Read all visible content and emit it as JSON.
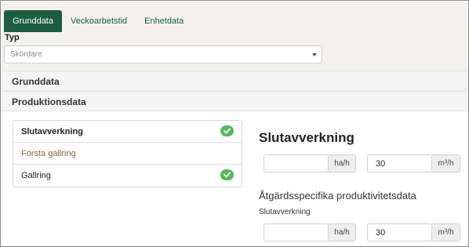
{
  "tabs": [
    {
      "label": "Grunddata",
      "active": true
    },
    {
      "label": "Veckoarbetstid",
      "active": false
    },
    {
      "label": "Enhetdata",
      "active": false
    }
  ],
  "typ": {
    "label": "Typ",
    "selected": "Skördare"
  },
  "sections": {
    "grunddata": "Grunddata",
    "produktionsdata": "Produktionsdata"
  },
  "list": {
    "items": [
      {
        "label": "Slutavverkning",
        "checked": true
      },
      {
        "label": "Första gallring",
        "checked": false
      },
      {
        "label": "Gallring",
        "checked": true
      }
    ]
  },
  "detail": {
    "title": "Slutavverkning",
    "row1": {
      "ha_value": "",
      "ha_unit": "ha/h",
      "m3_value": "30",
      "m3_unit": "m³/h"
    },
    "specific_title": "Åtgärdsspecifika produktivitetsdata",
    "specific_label": "Slutavverkning",
    "row2": {
      "ha_value": "",
      "ha_unit": "ha/h",
      "m3_value": "30",
      "m3_unit": "m³/h"
    }
  },
  "colors": {
    "accent": "#1d5e40",
    "check": "#5cb65c"
  }
}
